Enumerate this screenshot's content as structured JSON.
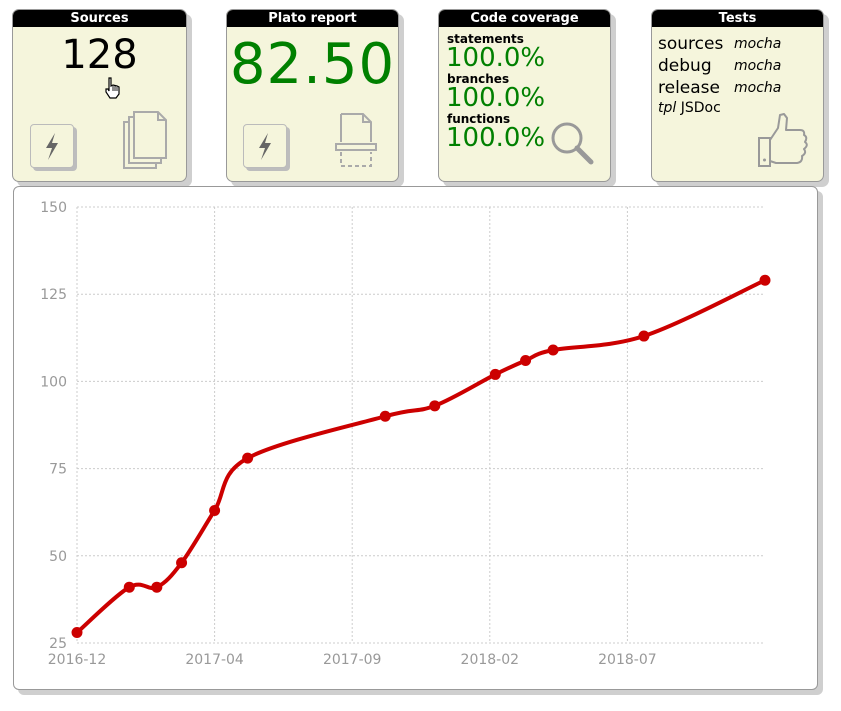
{
  "tiles": {
    "sources": {
      "title": "Sources",
      "count": "128",
      "icons": [
        "lightning-icon",
        "documents-icon",
        "hand-cursor-icon"
      ]
    },
    "plato": {
      "title": "Plato report",
      "score": "82.50",
      "icons": [
        "lightning-icon",
        "scanner-icon"
      ]
    },
    "coverage": {
      "title": "Code coverage",
      "items": [
        {
          "label": "statements",
          "value": "100.0%"
        },
        {
          "label": "branches",
          "value": "100.0%"
        },
        {
          "label": "functions",
          "value": "100.0%"
        }
      ],
      "icons": [
        "magnifier-icon"
      ]
    },
    "tests": {
      "title": "Tests",
      "rows": [
        {
          "name": "sources",
          "tool": "mocha"
        },
        {
          "name": "debug",
          "tool": "mocha"
        },
        {
          "name": "release",
          "tool": "mocha"
        }
      ],
      "tpl": {
        "name": "tpl",
        "tool": "JSDoc"
      },
      "icons": [
        "thumbs-up-icon"
      ]
    }
  },
  "colors": {
    "tile_bg": "#f5f5dc",
    "green": "#008000",
    "line": "#cc0000",
    "grid": "#cccccc",
    "tick": "#999999"
  },
  "chart_data": {
    "type": "line",
    "title": "",
    "xlabel": "",
    "ylabel": "",
    "x_tick_labels": [
      "2016-12",
      "2017-04",
      "2017-09",
      "2018-02",
      "2018-07"
    ],
    "y_ticks": [
      25,
      50,
      75,
      100,
      125,
      150
    ],
    "ylim": [
      25,
      150
    ],
    "grid": true,
    "x_unit": "months since 2016-10",
    "series": [
      {
        "name": "",
        "x": [
          0,
          1.9,
          2.9,
          3.8,
          5.0,
          6.2,
          11.2,
          13.0,
          15.2,
          16.3,
          17.3,
          20.6,
          25.0
        ],
        "values": [
          28,
          41,
          41,
          48,
          63,
          78,
          90,
          93,
          102,
          106,
          109,
          113,
          129
        ]
      }
    ]
  }
}
